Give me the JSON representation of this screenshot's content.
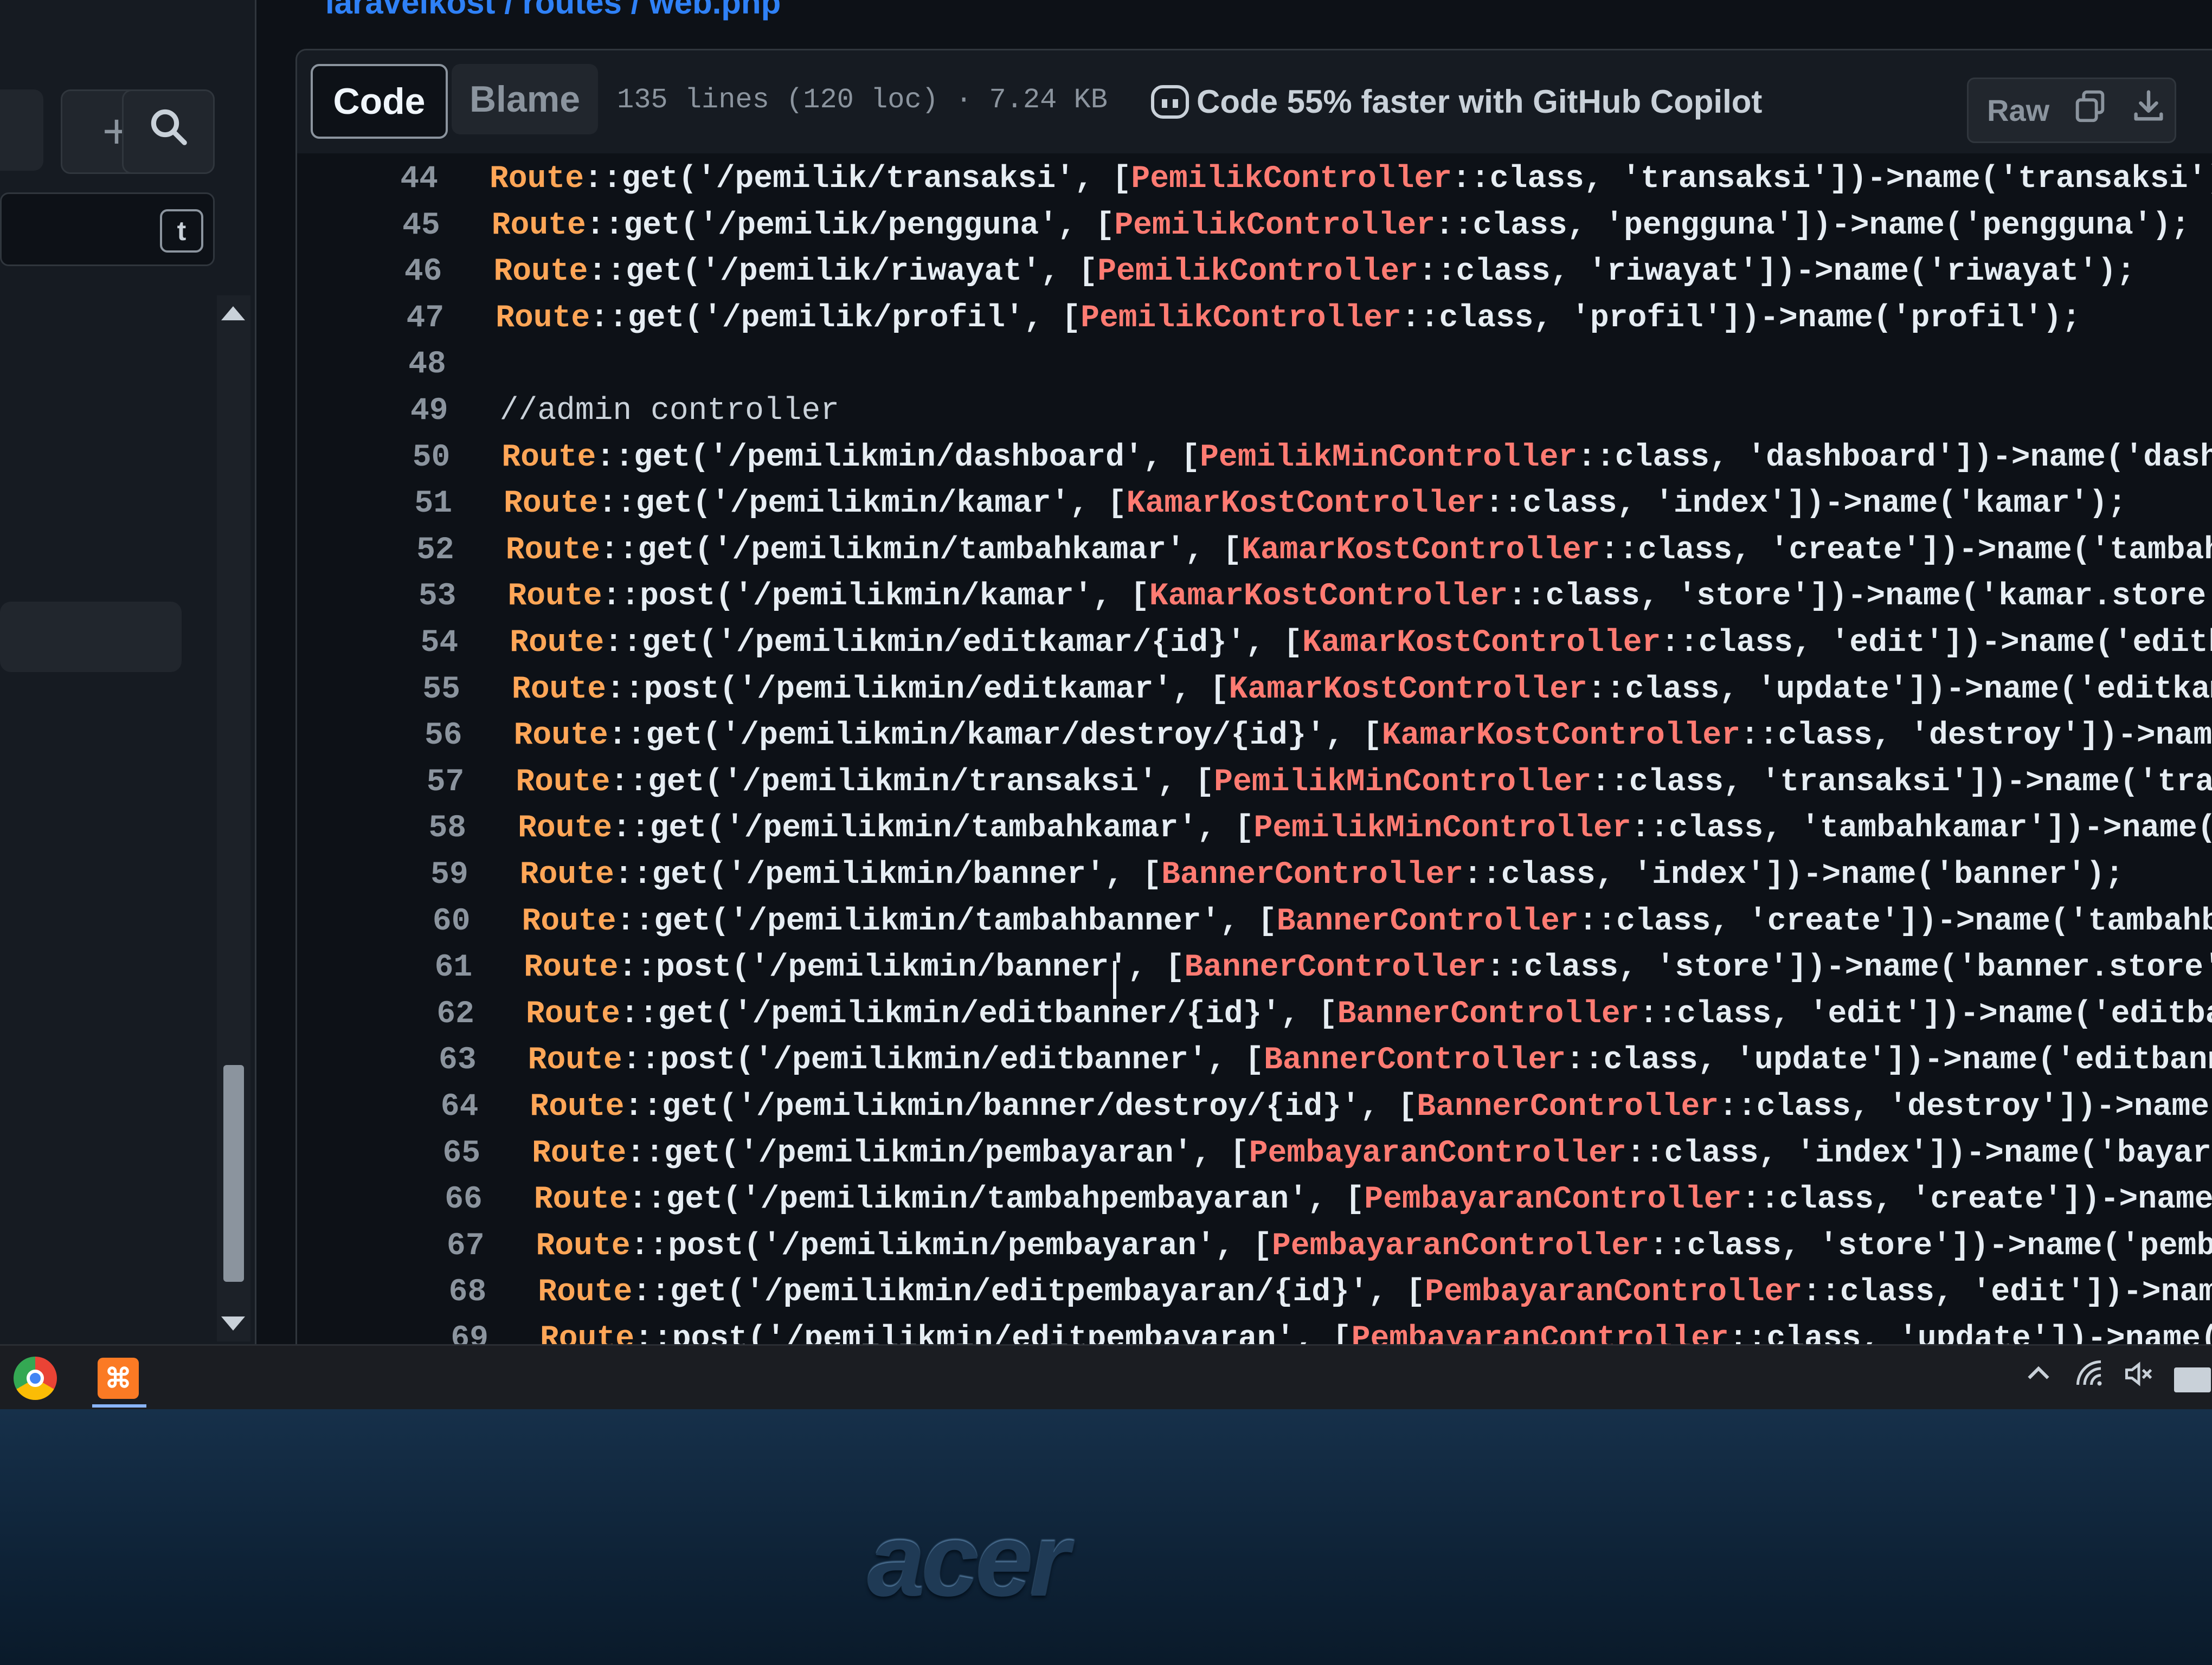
{
  "file": {
    "path": "laravelkost / routes / web.php",
    "tabs": {
      "code": "Code",
      "blame": "Blame"
    },
    "info": "135 lines (120 loc) · 7.24 KB",
    "copilot": "Code 55% faster with GitHub Copilot",
    "raw": "Raw"
  },
  "sidebar": {
    "filter_badge": "t"
  },
  "code": {
    "lines": [
      {
        "n": "44",
        "a": "Route",
        "b": "::get('/pemilik/transaksi', [",
        "c": "PemilikController",
        "d": "::class, 'transaksi'])->name('transaksi');"
      },
      {
        "n": "45",
        "a": "Route",
        "b": "::get('/pemilik/pengguna', [",
        "c": "PemilikController",
        "d": "::class, 'pengguna'])->name('pengguna');"
      },
      {
        "n": "46",
        "a": "Route",
        "b": "::get('/pemilik/riwayat', [",
        "c": "PemilikController",
        "d": "::class, 'riwayat'])->name('riwayat');"
      },
      {
        "n": "47",
        "a": "Route",
        "b": "::get('/pemilik/profil', [",
        "c": "PemilikController",
        "d": "::class, 'profil'])->name('profil');"
      },
      {
        "n": "48",
        "a": "",
        "b": "",
        "c": "",
        "d": ""
      },
      {
        "n": "49",
        "comment": "//admin controller"
      },
      {
        "n": "50",
        "a": "Route",
        "b": "::get('/pemilikmin/dashboard', [",
        "c": "PemilikMinController",
        "d": "::class, 'dashboard'])->name('dashboard');"
      },
      {
        "n": "51",
        "a": "Route",
        "b": "::get('/pemilikmin/kamar', [",
        "c": "KamarKostController",
        "d": "::class, 'index'])->name('kamar');"
      },
      {
        "n": "52",
        "a": "Route",
        "b": "::get('/pemilikmin/tambahkamar', [",
        "c": "KamarKostController",
        "d": "::class, 'create'])->name('tambahkamar');"
      },
      {
        "n": "53",
        "a": "Route",
        "b": "::post('/pemilikmin/kamar', [",
        "c": "KamarKostController",
        "d": "::class, 'store'])->name('kamar.store');"
      },
      {
        "n": "54",
        "a": "Route",
        "b": "::get('/pemilikmin/editkamar/{id}', [",
        "c": "KamarKostController",
        "d": "::class, 'edit'])->name('editkamar');"
      },
      {
        "n": "55",
        "a": "Route",
        "b": "::post('/pemilikmin/editkamar', [",
        "c": "KamarKostController",
        "d": "::class, 'update'])->name('editkamarPost');"
      },
      {
        "n": "56",
        "a": "Route",
        "b": "::get('/pemilikmin/kamar/destroy/{id}', [",
        "c": "KamarKostController",
        "d": "::class, 'destroy'])->name('destroy');"
      },
      {
        "n": "57",
        "a": "Route",
        "b": "::get('/pemilikmin/transaksi', [",
        "c": "PemilikMinController",
        "d": "::class, 'transaksi'])->name('transaksi');"
      },
      {
        "n": "58",
        "a": "Route",
        "b": "::get('/pemilikmin/tambahkamar', [",
        "c": "PemilikMinController",
        "d": "::class, 'tambahkamar'])->name('tambahkamar');"
      },
      {
        "n": "59",
        "a": "Route",
        "b": "::get('/pemilikmin/banner', [",
        "c": "BannerController",
        "d": "::class, 'index'])->name('banner');"
      },
      {
        "n": "60",
        "a": "Route",
        "b": "::get('/pemilikmin/tambahbanner', [",
        "c": "BannerController",
        "d": "::class, 'create'])->name('tambahbanner');"
      },
      {
        "n": "61",
        "a": "Route",
        "b": "::post('/pemilikmin/banner', [",
        "c": "BannerController",
        "d": "::class, 'store'])->name('banner.store');"
      },
      {
        "n": "62",
        "a": "Route",
        "b": "::get('/pemilikmin/editbanner/{id}', [",
        "c": "BannerController",
        "d": "::class, 'edit'])->name('editbanner');"
      },
      {
        "n": "63",
        "a": "Route",
        "b": "::post('/pemilikmin/editbanner', [",
        "c": "BannerController",
        "d": "::class, 'update'])->name('editbannerPost');"
      },
      {
        "n": "64",
        "a": "Route",
        "b": "::get('/pemilikmin/banner/destroy/{id}', [",
        "c": "BannerController",
        "d": "::class, 'destroy'])->name('destroy');"
      },
      {
        "n": "65",
        "a": "Route",
        "b": "::get('/pemilikmin/pembayaran', [",
        "c": "PembayaranController",
        "d": "::class, 'index'])->name('bayar');"
      },
      {
        "n": "66",
        "a": "Route",
        "b": "::get('/pemilikmin/tambahpembayaran', [",
        "c": "PembayaranController",
        "d": "::class, 'create'])->name('tambahpembayaran');"
      },
      {
        "n": "67",
        "a": "Route",
        "b": "::post('/pemilikmin/pembayaran', [",
        "c": "PembayaranController",
        "d": "::class, 'store'])->name('pembayaran.store');"
      },
      {
        "n": "68",
        "a": "Route",
        "b": "::get('/pemilikmin/editpembayaran/{id}', [",
        "c": "PembayaranController",
        "d": "::class, 'edit'])->name('editpembayaran');"
      },
      {
        "n": "69",
        "a": "Route",
        "b": "::post('/pemilikmin/editpembayaran', [",
        "c": "PembayaranController",
        "d": "::class, 'update'])->name('editpembayaranPost');"
      }
    ]
  },
  "taskbar": {
    "app_badge": "⌘"
  },
  "bezel": {
    "brand": "acer"
  },
  "colors": {
    "route_token": "#ffa657",
    "class_token": "#ff7b72",
    "code_bg": "#0d1117",
    "line_number": "#8b949e"
  },
  "icons": [
    "plus-icon",
    "search-icon",
    "copilot-icon",
    "copy-icon",
    "download-icon",
    "chrome-icon",
    "chevron-up-icon",
    "wifi-icon",
    "mute-icon",
    "battery-icon"
  ]
}
